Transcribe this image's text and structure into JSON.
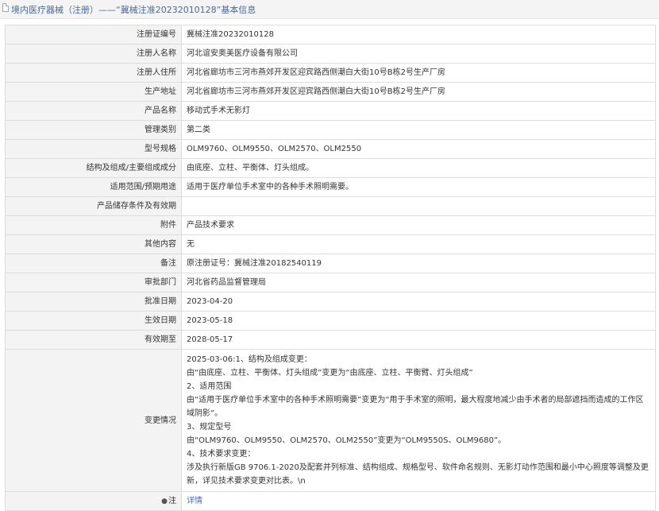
{
  "header": {
    "title": "境内医疗器械（注册）——“冀械注准20232010128”基本信息"
  },
  "rows": [
    {
      "label": "注册证编号",
      "value": "冀械注准20232010128"
    },
    {
      "label": "注册人名称",
      "value": "河北谊安奥美医疗设备有限公司"
    },
    {
      "label": "注册人住所",
      "value": "河北省廊坊市三河市燕郊开发区迎宾路西侧潮白大街10号B栋2号生产厂房"
    },
    {
      "label": "生产地址",
      "value": "河北省廊坊市三河市燕郊开发区迎宾路西侧潮白大街10号B栋2号生产厂房"
    },
    {
      "label": "产品名称",
      "value": "移动式手术无影灯"
    },
    {
      "label": "管理类别",
      "value": "第二类"
    },
    {
      "label": "型号规格",
      "value": "OLM9760、OLM9550、OLM2570、OLM2550"
    },
    {
      "label": "结构及组成/主要组成成分",
      "value": "由底座、立柱、平衡体、灯头组成。"
    },
    {
      "label": "适用范围/预期用途",
      "value": "适用于医疗单位手术室中的各种手术照明需要。"
    },
    {
      "label": "产品储存条件及有效期",
      "value": ""
    },
    {
      "label": "附件",
      "value": "产品技术要求"
    },
    {
      "label": "其他内容",
      "value": "无"
    },
    {
      "label": "备注",
      "value": "原注册证号：冀械注准20182540119"
    },
    {
      "label": "审批部门",
      "value": "河北省药品监督管理局"
    },
    {
      "label": "批准日期",
      "value": "2023-04-20"
    },
    {
      "label": "生效日期",
      "value": "2023-05-18"
    },
    {
      "label": "有效期至",
      "value": "2028-05-17"
    }
  ],
  "changes": {
    "label": "变更情况",
    "lines": [
      "2025-03-06:1、结构及组成变更：",
      "由“由底座、立柱、平衡体、灯头组成”变更为“由底座、立柱、平衡臂、灯头组成”",
      "2、适用范围",
      "由“适用于医疗单位手术室中的各种手术照明需要”变更为“用于手术室的照明，最大程度地减少由手术者的局部遮挡而造成的工作区域阴影”。",
      "3、规定型号",
      "由“OLM9760、OLM9550、OLM2570、OLM2550”变更为“OLM9550S、OLM9680”。",
      "4、技术要求变更：",
      "涉及执行新版GB 9706.1-2020及配套并列标准、结构组成、规格型号、软件命名规则、无影灯动作范围和最小中心照度等调整及更新，详见技术要求变更对比表。\\n"
    ]
  },
  "note": {
    "label": "注",
    "icon": "pin-icon",
    "link": "详情"
  }
}
